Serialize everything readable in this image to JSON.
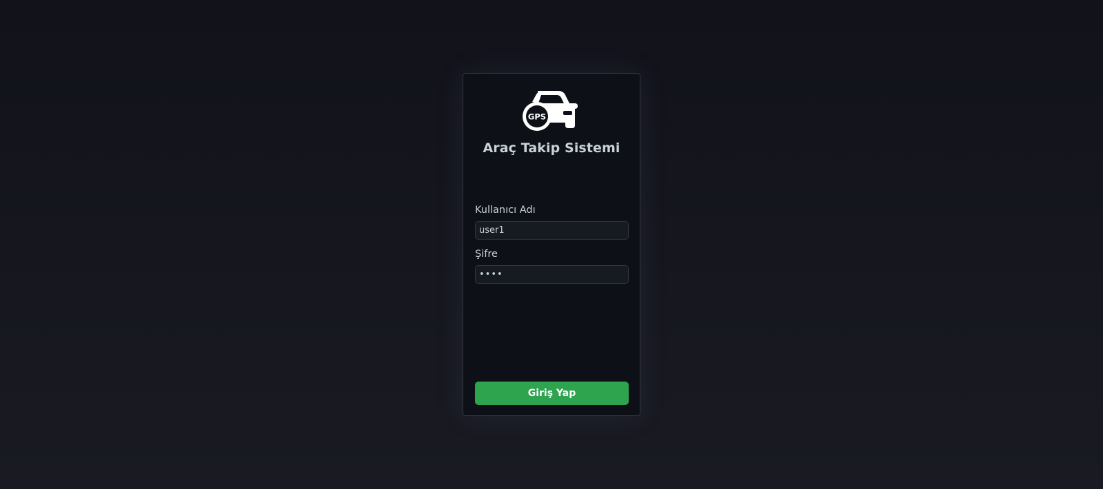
{
  "app": {
    "title": "Araç Takip Sistemi",
    "logo_icon": "gps-car-icon",
    "logo_text": "GPS"
  },
  "form": {
    "username_label": "Kullanıcı Adı",
    "username_value": "user1",
    "password_label": "Şifre",
    "password_value": "••••",
    "submit_label": "Giriş Yap"
  },
  "colors": {
    "page_background": "#13141b",
    "card_background": "#0d1117",
    "card_border": "#30363d",
    "input_background": "#161b22",
    "text": "#c9d1d9",
    "accent_button": "#2ea44f"
  }
}
